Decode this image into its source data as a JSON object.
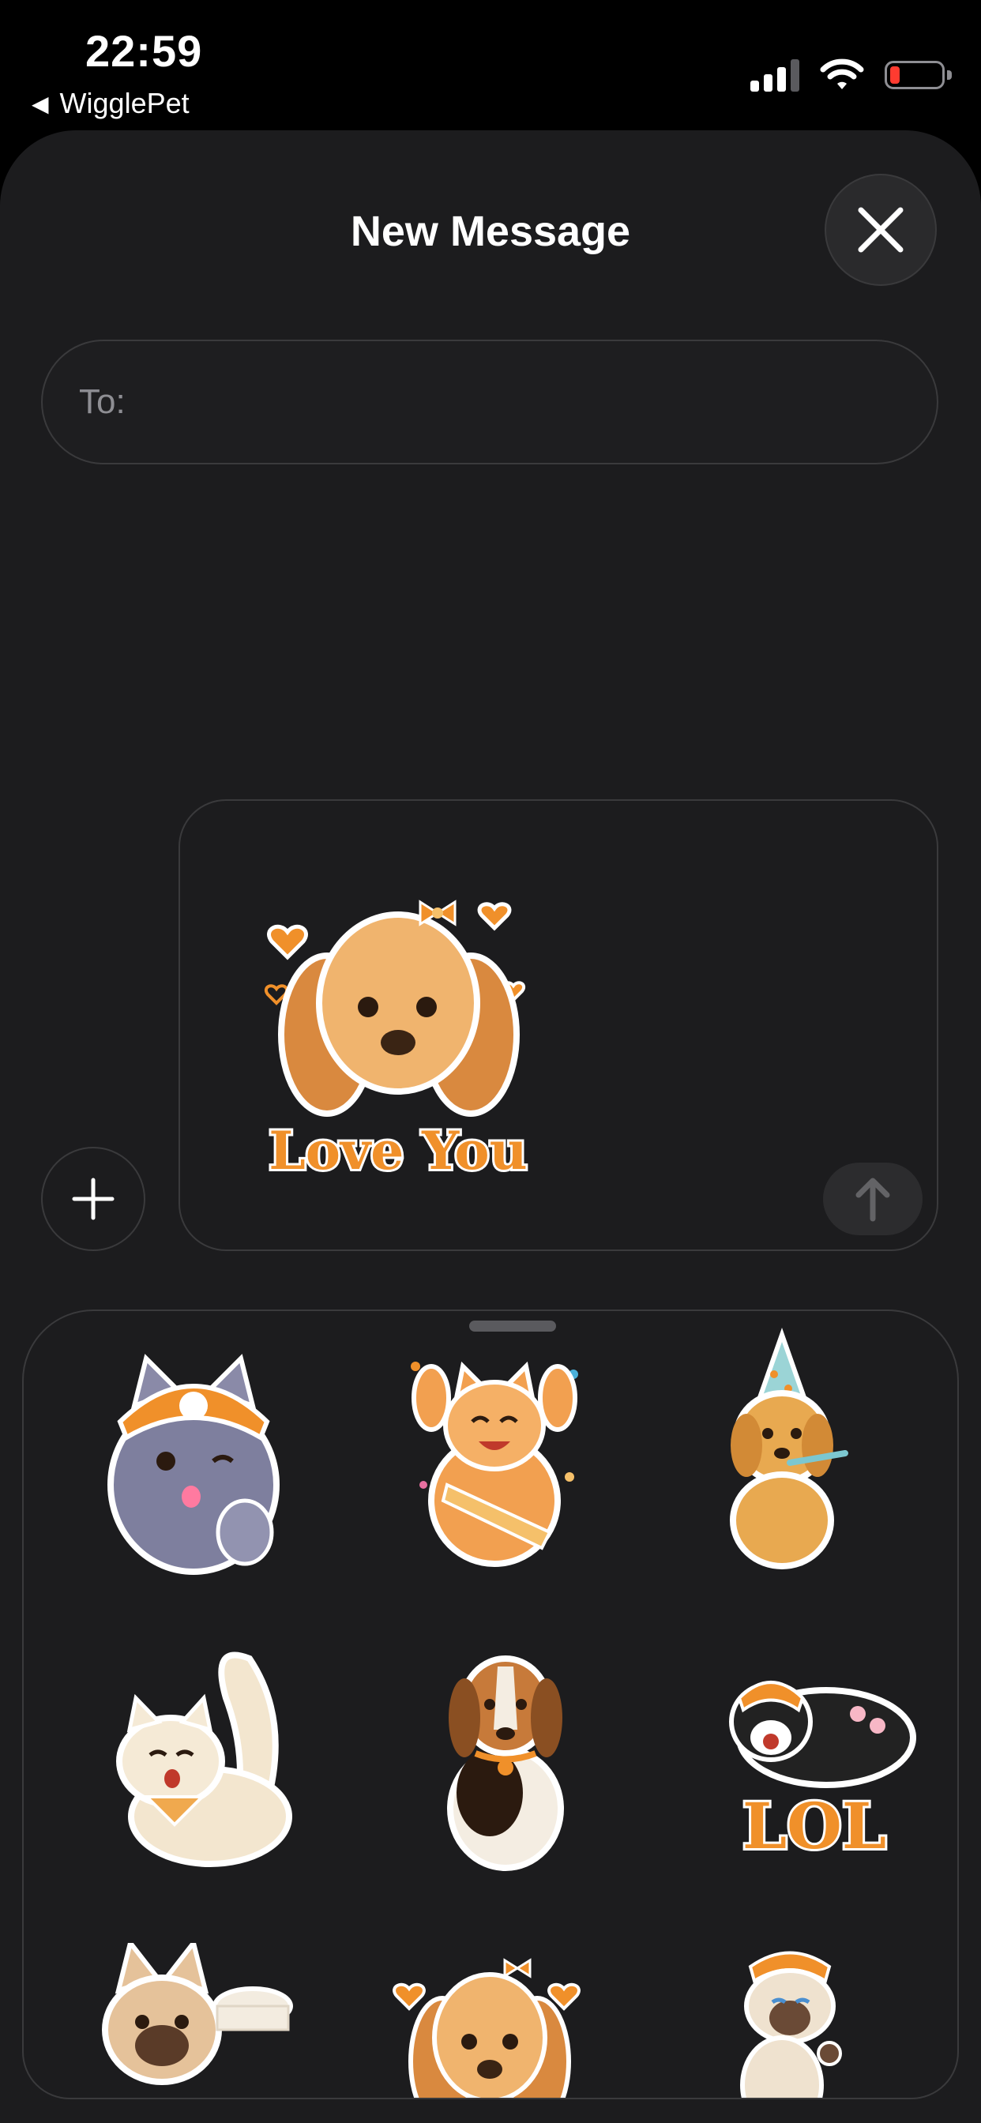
{
  "status_bar": {
    "time": "22:59",
    "back_app": "WigglePet"
  },
  "sheet": {
    "title": "New Message",
    "to_label": "To:"
  },
  "compose": {
    "sticker": {
      "name": "cocker-spaniel-love-you",
      "caption": "Love You"
    }
  },
  "sticker_tray": {
    "stickers": [
      {
        "name": "gray-cat-wink-thumbs-up"
      },
      {
        "name": "orange-cat-celebrating"
      },
      {
        "name": "golden-retriever-party-hat"
      },
      {
        "name": "fluffy-cat-stretching"
      },
      {
        "name": "beagle-sitting"
      },
      {
        "name": "tuxedo-cat-lol",
        "caption": "LOL"
      },
      {
        "name": "french-bulldog-bowl"
      },
      {
        "name": "cocker-spaniel-hearts"
      },
      {
        "name": "siamese-cat-ok"
      }
    ]
  },
  "colors": {
    "accent": "#f0902a",
    "sheet_bg": "#1c1c1e",
    "border": "#3a3a3c"
  }
}
